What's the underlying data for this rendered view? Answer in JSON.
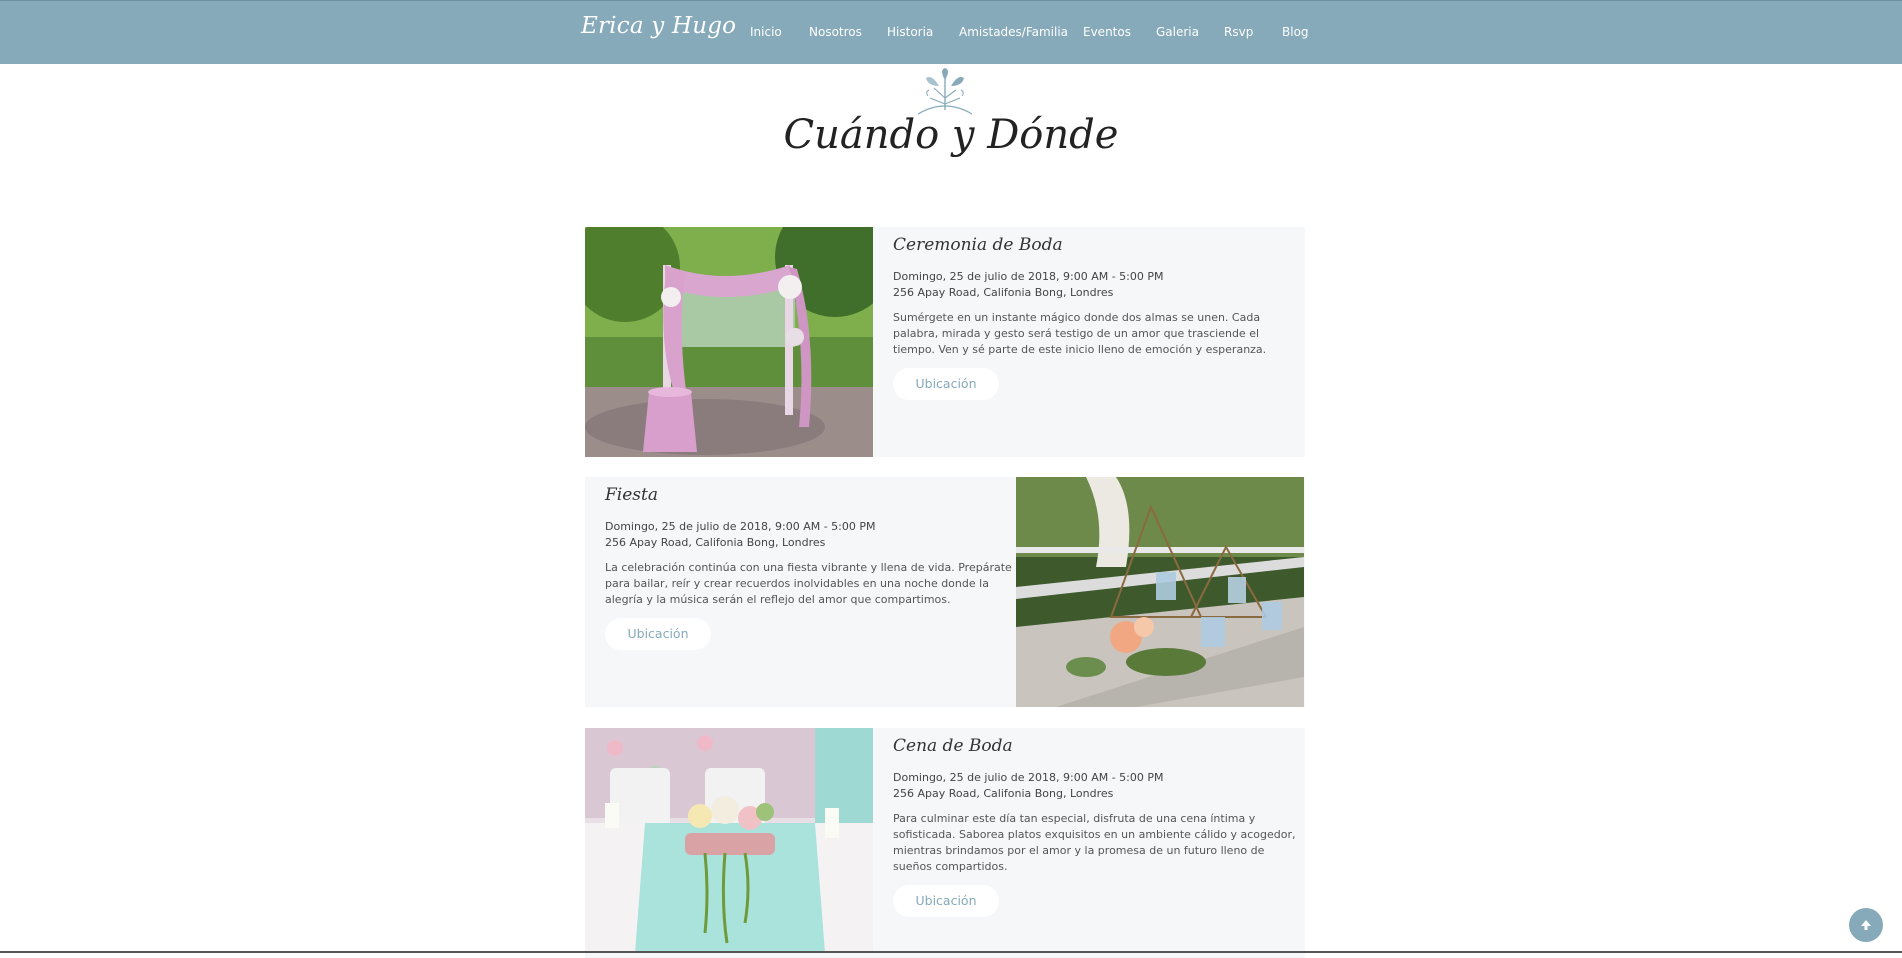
{
  "nav": {
    "brand": "Erica y Hugo",
    "links": [
      "Inicio",
      "Nosotros",
      "Historia",
      "Amistades/Familia",
      "Eventos",
      "Galeria",
      "Rsvp",
      "Blog"
    ]
  },
  "section": {
    "title": "Cuándo y Dónde"
  },
  "events": [
    {
      "title": "Ceremonia de Boda",
      "date": "Domingo, 25 de julio de 2018, 9:00 AM - 5:00 PM",
      "address": "256 Apay Road, Califonia Bong, Londres",
      "description": "Sumérgete en un instante mágico donde dos almas se unen. Cada palabra, mirada y gesto será testigo de un amor que trasciende el tiempo. Ven y sé parte de este inicio lleno de emoción y esperanza.",
      "button": "Ubicación",
      "image": "wedding-arch-photo"
    },
    {
      "title": "Fiesta",
      "date": "Domingo, 25 de julio de 2018, 9:00 AM - 5:00 PM",
      "address": "256 Apay Road, Califonia Bong, Londres",
      "description": "La celebración continúa con una fiesta vibrante y llena de vida. Prepárate para bailar, reír y crear recuerdos inolvidables en una noche donde la alegría y la música serán el reflejo del amor que compartimos.",
      "button": "Ubicación",
      "image": "table-centerpiece-photo"
    },
    {
      "title": "Cena de Boda",
      "date": "Domingo, 25 de julio de 2018, 9:00 AM - 5:00 PM",
      "address": "256 Apay Road, Califonia Bong, Londres",
      "description": "Para culminar este día tan especial, disfruta de una cena íntima y sofisticada. Saborea platos exquisitos en un ambiente cálido y acogedor, mientras brindamos por el amor y la promesa de un futuro lleno de sueños compartidos.",
      "button": "Ubicación",
      "image": "dinner-table-photo"
    }
  ],
  "colors": {
    "accent": "#86aab9",
    "card_bg": "#f6f7f9"
  },
  "icons": {
    "scroll_top": "arrow-up-icon",
    "ornament": "floral-ornament-icon"
  }
}
